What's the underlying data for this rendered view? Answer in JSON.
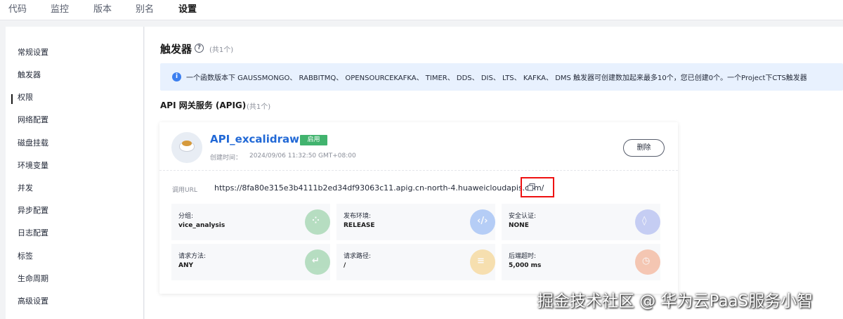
{
  "topnav": {
    "tabs": [
      {
        "label": "代码"
      },
      {
        "label": "监控"
      },
      {
        "label": "版本"
      },
      {
        "label": "别名"
      },
      {
        "label": "设置",
        "active": true
      }
    ]
  },
  "sidebar": {
    "items": [
      {
        "label": "常规设置"
      },
      {
        "label": "触发器",
        "active": true
      },
      {
        "label": "权限"
      },
      {
        "label": "网络配置"
      },
      {
        "label": "磁盘挂载"
      },
      {
        "label": "环境变量"
      },
      {
        "label": "并发"
      },
      {
        "label": "异步配置"
      },
      {
        "label": "日志配置"
      },
      {
        "label": "标签"
      },
      {
        "label": "生命周期"
      },
      {
        "label": "高级设置"
      }
    ]
  },
  "main": {
    "title": "触发器",
    "count": "(共1个)",
    "banner": "一个函数版本下 GAUSSMONGO、 RABBITMQ、 OPENSOURCEKAFKA、 TIMER、 DDS、 DIS、 LTS、 KAFKA、 DMS 触发器可创建数加起来最多10个，您已创建0个。一个Project下CTS触发器",
    "section_title": "API 网关服务 (APIG)",
    "section_count": "(共1个)"
  },
  "card": {
    "name": "API_excalidraw",
    "status": "启用",
    "created_label": "创建时间：",
    "created_value": "2024/09/06 11:32:50 GMT+08:00",
    "delete_label": "删除",
    "url_label": "调用URL",
    "url_value": "https://8fa80e315e3b4111b2ed34df93063c11.apig.cn-north-4.huaweicloudapis.com/",
    "fields": [
      {
        "label": "分组:",
        "value": "vice_analysis",
        "icon": "group-icon",
        "color": "#3fae5a"
      },
      {
        "label": "发布环境:",
        "value": "RELEASE",
        "icon": "code-icon",
        "color": "#3c7fef"
      },
      {
        "label": "安全认证:",
        "value": "NONE",
        "icon": "shield-icon",
        "color": "#6a7ee8"
      },
      {
        "label": "请求方法:",
        "value": "ANY",
        "icon": "method-icon",
        "color": "#3fae5a"
      },
      {
        "label": "请求路径:",
        "value": "/",
        "icon": "path-icon",
        "color": "#f5b326"
      },
      {
        "label": "后端超时:",
        "value": "5,000 ms",
        "icon": "timer-icon",
        "color": "#f06a2e"
      }
    ]
  },
  "watermark": "掘金技术社区 @ 华为云PaaS服务小智",
  "colors": {
    "accent": "#2269d6",
    "badge": "#41b36e",
    "banner": "#e8f1fe",
    "highlight": "#ee1111"
  }
}
